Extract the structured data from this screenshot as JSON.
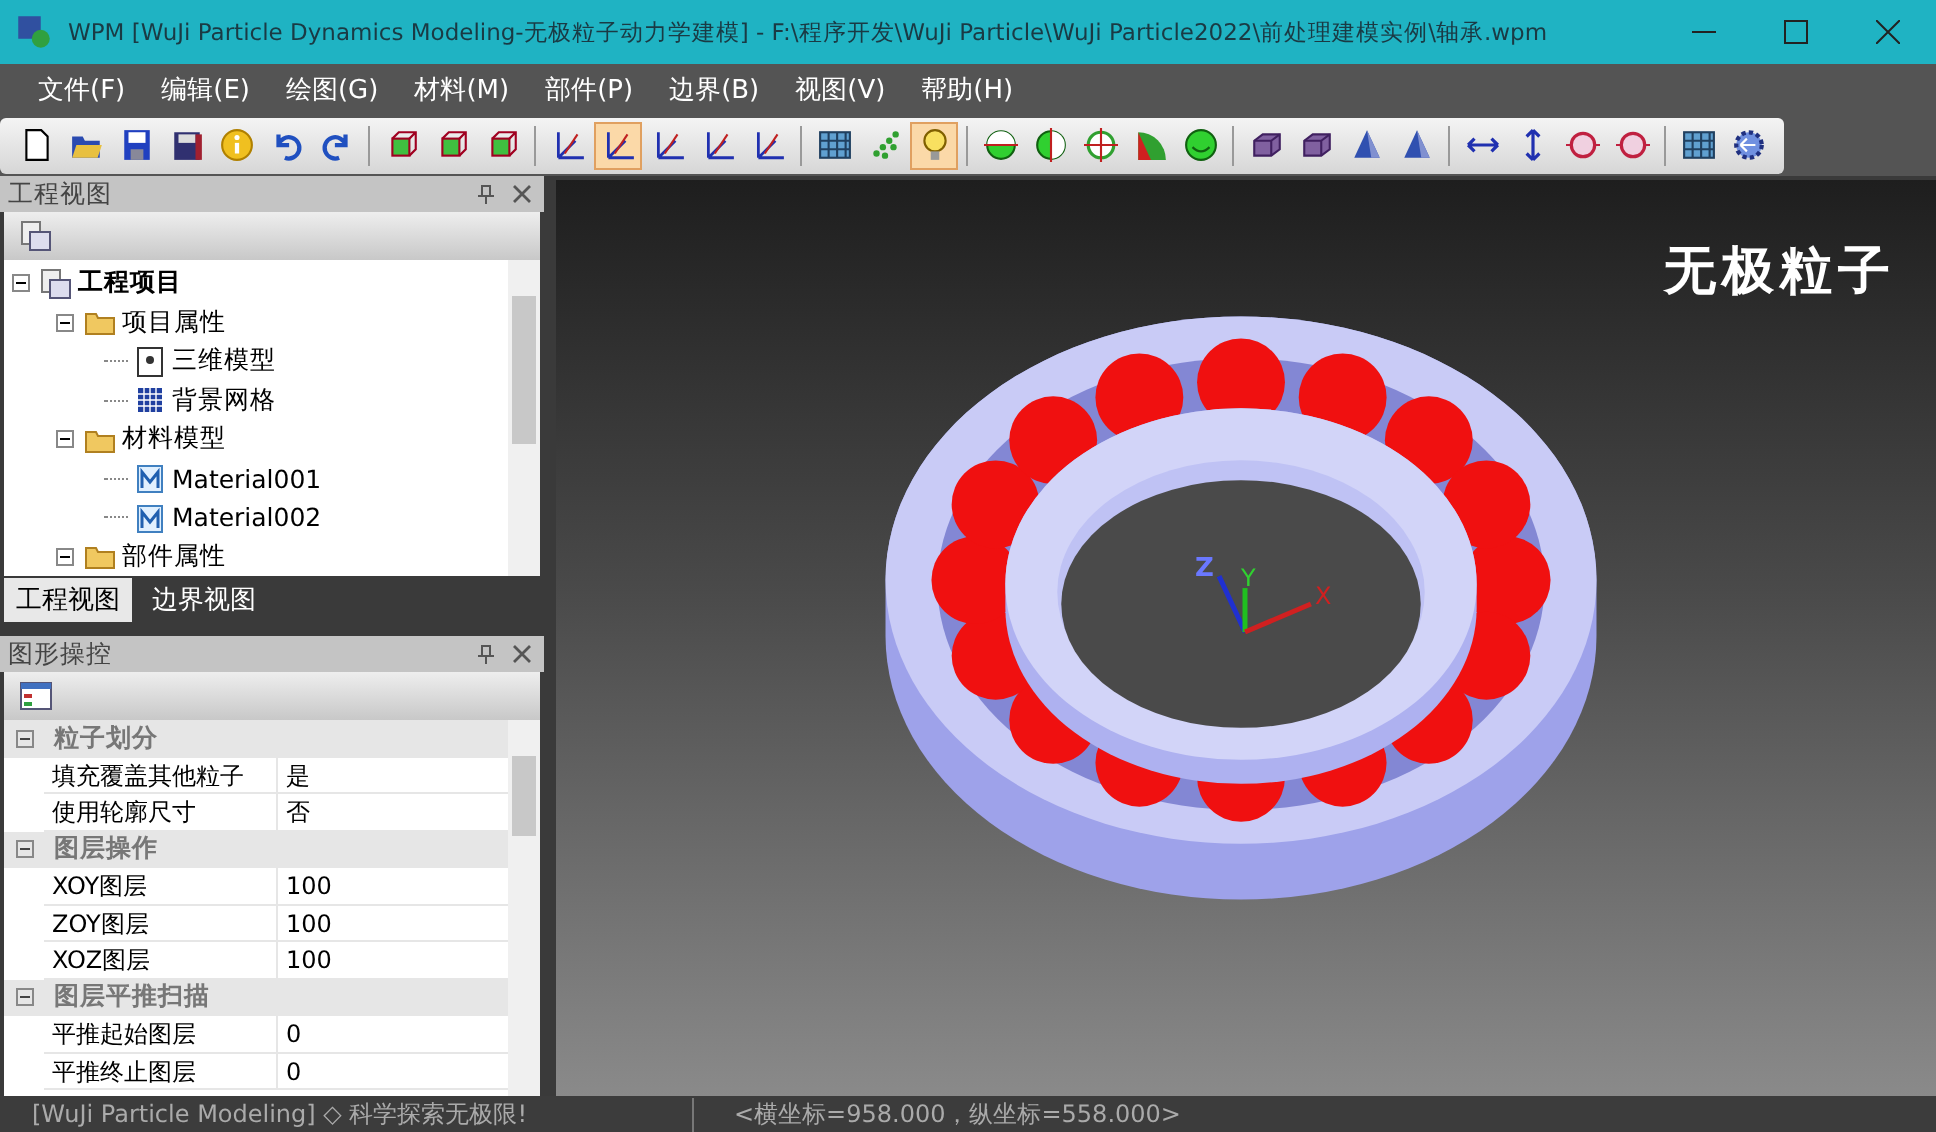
{
  "window": {
    "title": "WPM [WuJi Particle Dynamics Modeling-无极粒子动力学建模] - F:\\程序开发\\WuJi Particle\\WuJi Particle2022\\前处理建模实例\\轴承.wpm"
  },
  "menu": [
    "文件(F)",
    "编辑(E)",
    "绘图(G)",
    "材料(M)",
    "部件(P)",
    "边界(B)",
    "视图(V)",
    "帮助(H)"
  ],
  "toolbar": [
    [
      {
        "kind": "new",
        "selected": false
      },
      {
        "kind": "open",
        "selected": false
      },
      {
        "kind": "save",
        "selected": false
      },
      {
        "kind": "saveall",
        "selected": false
      },
      {
        "kind": "info",
        "selected": false
      },
      {
        "kind": "undo",
        "selected": false
      },
      {
        "kind": "redo",
        "selected": false
      }
    ],
    [
      {
        "kind": "cube",
        "selected": false
      },
      {
        "kind": "cube",
        "selected": false
      },
      {
        "kind": "cube",
        "selected": false
      }
    ],
    [
      {
        "kind": "axes",
        "selected": false
      },
      {
        "kind": "axes",
        "selected": true
      },
      {
        "kind": "axes",
        "selected": false
      },
      {
        "kind": "axes",
        "selected": false
      },
      {
        "kind": "axes",
        "selected": false
      }
    ],
    [
      {
        "kind": "grid",
        "selected": false
      },
      {
        "kind": "dots",
        "selected": false
      },
      {
        "kind": "bulb",
        "selected": true
      }
    ],
    [
      {
        "kind": "circle-h",
        "selected": false
      },
      {
        "kind": "circle-v",
        "selected": false
      },
      {
        "kind": "circle-cross",
        "selected": false
      },
      {
        "kind": "sector",
        "selected": false
      },
      {
        "kind": "smile",
        "selected": false
      }
    ],
    [
      {
        "kind": "box",
        "selected": false
      },
      {
        "kind": "box",
        "selected": false
      },
      {
        "kind": "cone",
        "selected": false
      },
      {
        "kind": "cone",
        "selected": false
      }
    ],
    [
      {
        "kind": "move-h",
        "selected": false
      },
      {
        "kind": "move-v",
        "selected": false
      },
      {
        "kind": "frame",
        "selected": false
      },
      {
        "kind": "frame",
        "selected": false
      }
    ],
    [
      {
        "kind": "grid",
        "selected": false
      },
      {
        "kind": "back",
        "selected": false
      }
    ]
  ],
  "project_panel": {
    "title": "工程视图",
    "tree": [
      {
        "label": "工程项目",
        "kind": "project",
        "expanded": true,
        "children": [
          {
            "label": "项目属性",
            "kind": "folder",
            "expanded": true,
            "children": [
              {
                "label": "三维模型",
                "kind": "model"
              },
              {
                "label": "背景网格",
                "kind": "mesh"
              }
            ]
          },
          {
            "label": "材料模型",
            "kind": "folder",
            "expanded": true,
            "children": [
              {
                "label": "Material001",
                "kind": "material"
              },
              {
                "label": "Material002",
                "kind": "material"
              }
            ]
          },
          {
            "label": "部件属性",
            "kind": "folder",
            "expanded": true
          }
        ]
      }
    ],
    "tabs": [
      {
        "label": "工程视图",
        "selected": true
      },
      {
        "label": "边界视图",
        "selected": false
      }
    ]
  },
  "graphics_panel": {
    "title": "图形操控",
    "categories": [
      {
        "label": "粒子划分",
        "expanded": true,
        "rows": [
          {
            "name": "填充覆盖其他粒子",
            "value": "是"
          },
          {
            "name": "使用轮廓尺寸",
            "value": "否"
          }
        ]
      },
      {
        "label": "图层操作",
        "expanded": true,
        "rows": [
          {
            "name": "XOY图层",
            "value": "100"
          },
          {
            "name": "ZOY图层",
            "value": "100"
          },
          {
            "name": "XOZ图层",
            "value": "100"
          }
        ]
      },
      {
        "label": "图层平推扫描",
        "expanded": true,
        "rows": [
          {
            "name": "平推起始图层",
            "value": "0"
          },
          {
            "name": "平推终止图层",
            "value": "0"
          }
        ]
      }
    ]
  },
  "viewport": {
    "logo": "无极粒子",
    "axes": [
      "X",
      "Y",
      "Z"
    ]
  },
  "status_bar": {
    "left": "[WuJi Particle Modeling] ◇ 科学探索无极限!",
    "right": "<横坐标=958.000，纵坐标=558.000>"
  }
}
